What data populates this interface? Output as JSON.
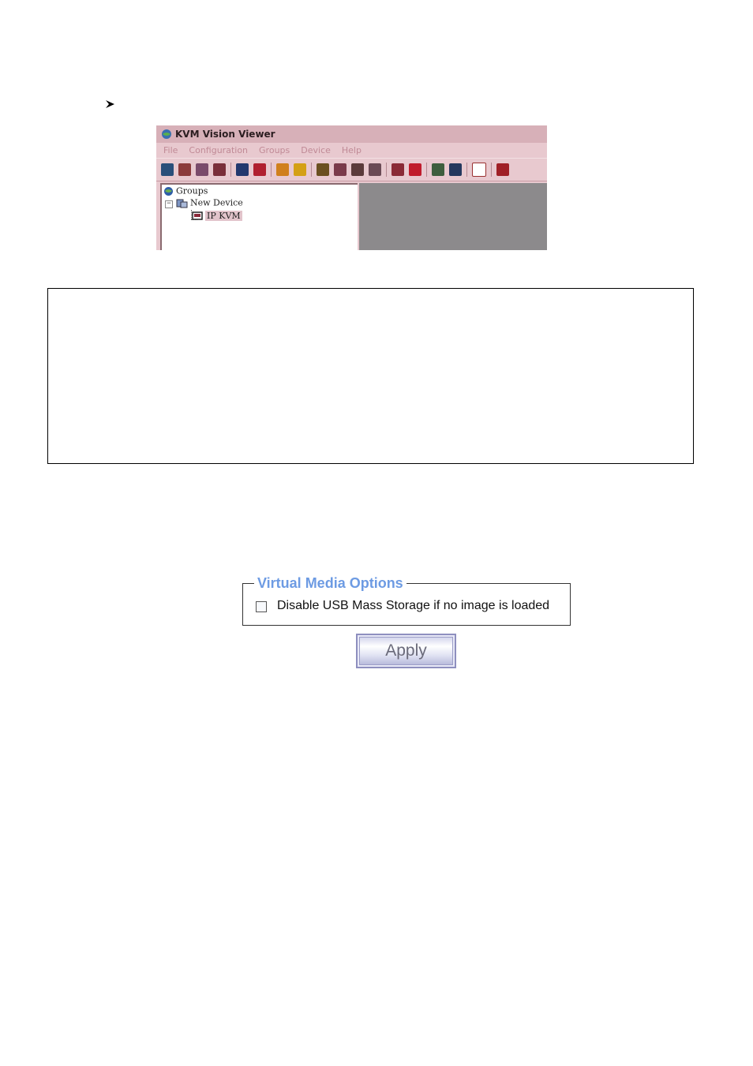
{
  "kvm_window": {
    "title": "KVM Vision Viewer",
    "menu": [
      "File",
      "Configuration",
      "Groups",
      "Device",
      "Help"
    ],
    "toolbar_icons": [
      {
        "name": "connect-icon",
        "color": "#2a4f7a"
      },
      {
        "name": "disconnect-icon",
        "color": "#8b3b3b"
      },
      {
        "name": "link-icon",
        "color": "#7a4b6b"
      },
      {
        "name": "unlink-icon",
        "color": "#7a2f3a"
      },
      {
        "name": "monitor-icon",
        "color": "#23386e"
      },
      {
        "name": "monitor-remove-icon",
        "color": "#b02030"
      },
      {
        "name": "settings-icon",
        "color": "#d0801d"
      },
      {
        "name": "search-icon",
        "color": "#d4a015"
      },
      {
        "name": "lightning-icon",
        "color": "#6b5020"
      },
      {
        "name": "star-icon",
        "color": "#7a3b4b"
      },
      {
        "name": "grid-icon",
        "color": "#5b3b3b"
      },
      {
        "name": "cross-icon",
        "color": "#6a4a55"
      },
      {
        "name": "stop-icon",
        "color": "#8a2a36"
      },
      {
        "name": "close-box-icon",
        "color": "#c01c2c"
      },
      {
        "name": "chart-icon",
        "color": "#3e5e3e"
      },
      {
        "name": "device-icon",
        "color": "#24385e"
      },
      {
        "name": "tree-icon",
        "color": "#9a3030"
      },
      {
        "name": "exit-icon",
        "color": "#a02027"
      }
    ],
    "tree": {
      "root": "Groups",
      "child": "New Device",
      "leaf": "IP KVM"
    }
  },
  "virtual_media": {
    "legend": "Virtual Media Options",
    "checkbox_label": "Disable USB Mass Storage if no image is loaded",
    "checkbox_checked": false,
    "apply_label": "Apply"
  }
}
